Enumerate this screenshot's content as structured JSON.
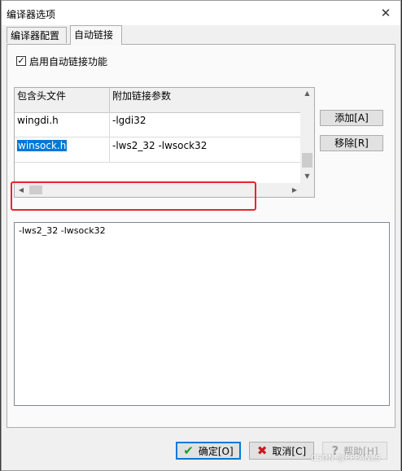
{
  "window": {
    "title": "编译器选项",
    "close_symbol": "✕"
  },
  "tabs": [
    {
      "label": "编译器配置",
      "active": false
    },
    {
      "label": "自动链接",
      "active": true
    }
  ],
  "auto_link": {
    "enable_label": "启用自动链接功能",
    "enable_checked": true,
    "checkmark": "✓"
  },
  "grid": {
    "columns": [
      "包含头文件",
      "附加链接参数"
    ],
    "rows": [
      {
        "header": "wingdi.h",
        "params": "-lgdi32"
      },
      {
        "header": "winsock.h",
        "params": "-lws2_32 -lwsock32",
        "selected": true
      }
    ],
    "scroll_up": "▲",
    "scroll_down": "▼",
    "scroll_left": "◀",
    "scroll_right": "▶"
  },
  "side_buttons": {
    "add": "添加[A]",
    "remove": "移除[R]"
  },
  "params_text": "-lws2_32 -lwsock32",
  "buttons": {
    "ok": "确定[O]",
    "ok_icon": "✔",
    "cancel": "取消[C]",
    "cancel_icon": "✖",
    "help": "帮助[H]",
    "help_icon": "?"
  },
  "watermark": "CSDN @PPPANLS",
  "colors": {
    "accent": "#0078d7",
    "highlight_box": "#e8262b",
    "ok_icon": "#1f9a2e",
    "cancel_icon": "#c8191e"
  }
}
